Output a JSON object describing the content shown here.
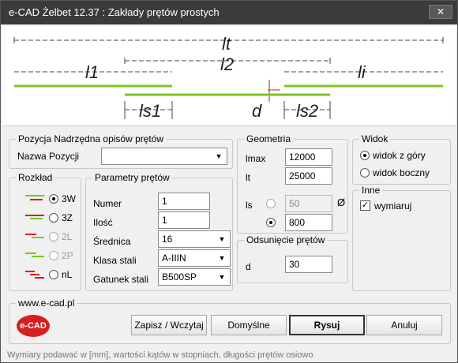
{
  "window": {
    "title": "e-CAD Żelbet 12.37 : Zakłady prętów prostych",
    "close_glyph": "✕"
  },
  "diagram": {
    "lt": "lt",
    "l1": "l1",
    "l2": "l2",
    "li": "li",
    "ls1": "ls1",
    "ls2": "ls2",
    "d": "d"
  },
  "pozycja": {
    "legend": "Pozycja Nadrzędna opisów prętów",
    "label": "Nazwa Pozycji",
    "value": ""
  },
  "geometria": {
    "legend": "Geometria",
    "lmax_label": "lmax",
    "lmax_value": "12000",
    "lt_label": "lt",
    "lt_value": "25000",
    "ls_label": "ls",
    "ls_opt1_value": "50",
    "ls_opt2_value": "800",
    "phi_glyph": "Ø"
  },
  "widok": {
    "legend": "Widok",
    "opt1": "widok z góry",
    "opt2": "widok boczny",
    "selected": "widok z góry"
  },
  "rozklad": {
    "legend": "Rozkład",
    "options": [
      "3W",
      "3Z",
      "2L",
      "2P",
      "nL"
    ],
    "selected": "3W"
  },
  "parametry": {
    "legend": "Parametry prętów",
    "numer_label": "Numer",
    "numer_value": "1",
    "ilosc_label": "Ilość",
    "ilosc_value": "1",
    "srednica_label": "Średnica",
    "srednica_value": "16",
    "klasa_label": "Klasa stali",
    "klasa_value": "A-IIIN",
    "gatunek_label": "Gatunek stali",
    "gatunek_value": "B500SP"
  },
  "odsuniecie": {
    "legend": "Odsunięcie prętów",
    "d_label": "d",
    "d_value": "30"
  },
  "inne": {
    "legend": "Inne",
    "wymiaruj_label": "wymiaruj",
    "wymiaruj_checked": true
  },
  "footer": {
    "legend": "www.e-cad.pl",
    "logo_text": "e-CAD",
    "zapisz": "Zapisz / Wczytaj",
    "domyslne": "Domyślne",
    "rysuj": "Rysuj",
    "anuluj": "Anuluj"
  },
  "status": "Wymiary podawać w [mm], wartości kątów w stopniach, długości prętów osiowo",
  "colors": {
    "bar_green": "#7dc41f",
    "bar_red": "#d62020",
    "titlebar": "#3b3b3b",
    "logo_red": "#d62020"
  }
}
